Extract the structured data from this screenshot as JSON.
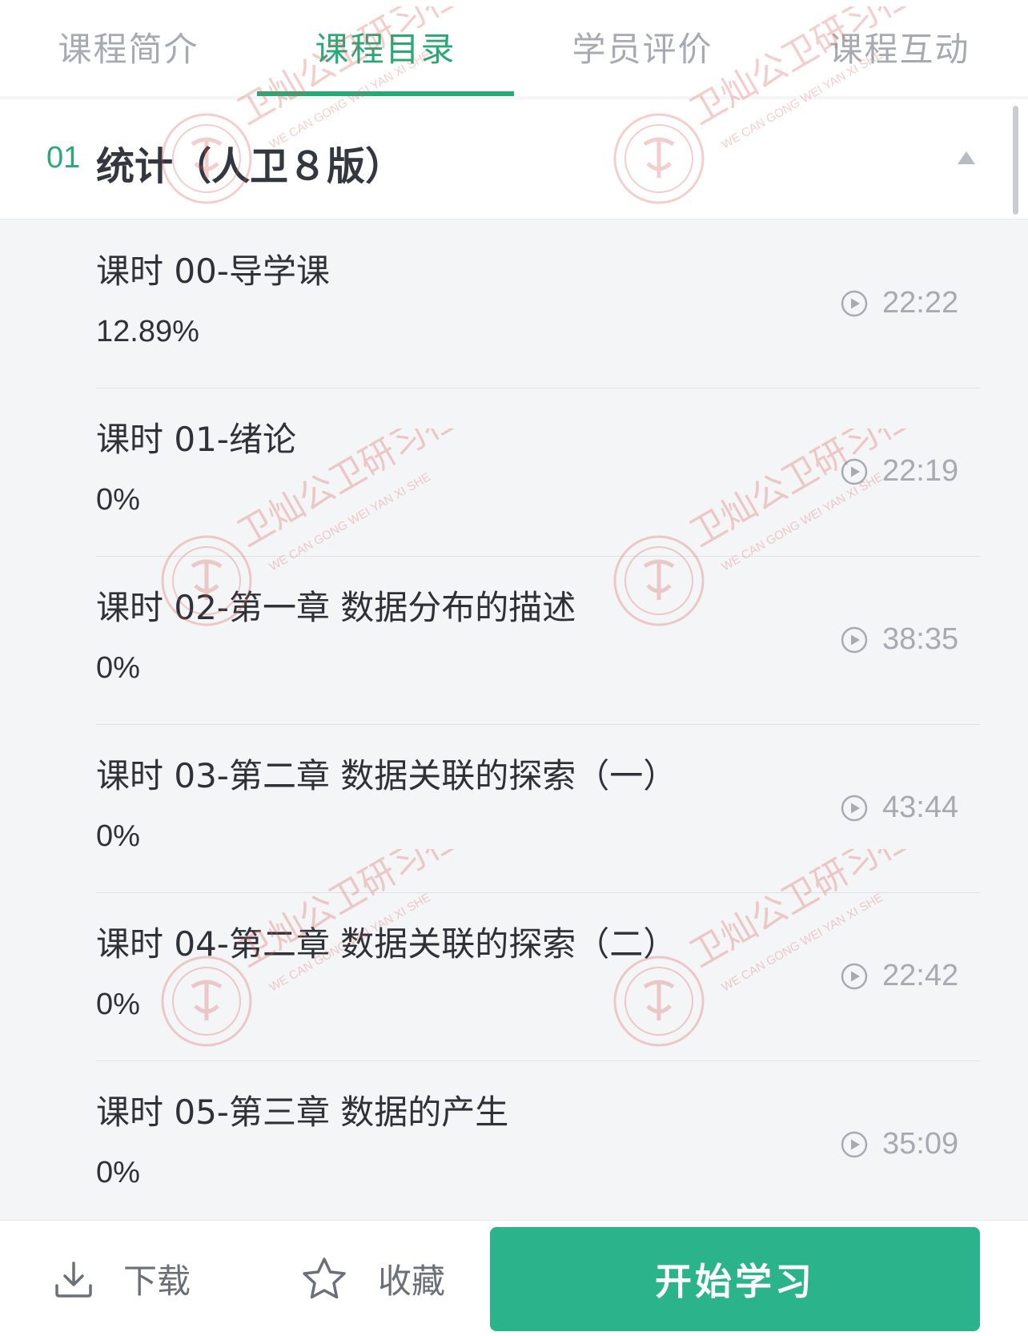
{
  "tabs": [
    {
      "label": "课程简介",
      "active": false
    },
    {
      "label": "课程目录",
      "active": true
    },
    {
      "label": "学员评价",
      "active": false
    },
    {
      "label": "课程互动",
      "active": false
    }
  ],
  "chapter": {
    "number": "01",
    "title": "统计（人卫８版）"
  },
  "lessons": [
    {
      "title": "课时 00-导学课",
      "progress": "12.89%",
      "duration": "22:22"
    },
    {
      "title": "课时 01-绪论",
      "progress": "0%",
      "duration": "22:19"
    },
    {
      "title": "课时 02-第一章 数据分布的描述",
      "progress": "0%",
      "duration": "38:35"
    },
    {
      "title": "课时 03-第二章 数据关联的探索（一）",
      "progress": "0%",
      "duration": "43:44"
    },
    {
      "title": "课时 04-第二章 数据关联的探索（二）",
      "progress": "0%",
      "duration": "22:42"
    },
    {
      "title": "课时 05-第三章 数据的产生",
      "progress": "0%",
      "duration": "35:09"
    }
  ],
  "watermark": {
    "cn": "卫灿公卫研习社",
    "en": "WE CAN GONG WEI YAN XI SHE",
    "seal": "WEICANGONGWEIYANXISHE"
  },
  "bottom": {
    "download_label": "下载",
    "favorite_label": "收藏",
    "start_label": "开始学习"
  },
  "colors": {
    "accent": "#2aa876",
    "button": "#2bb38b",
    "watermark": "#d9534f"
  },
  "icons": {
    "download": "download-icon",
    "favorite": "star-outline-icon",
    "play": "play-circle-icon",
    "collapse": "triangle-up-icon"
  }
}
